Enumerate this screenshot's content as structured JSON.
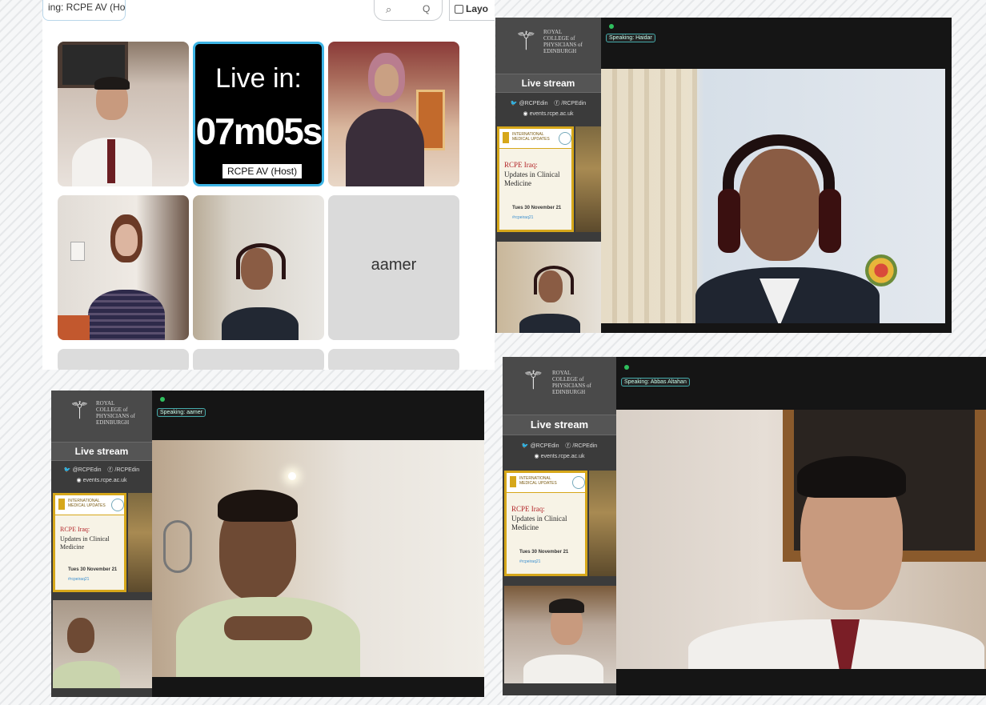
{
  "gallery": {
    "header_label": "ing: RCPE AV (Host)",
    "search_placeholder": "Q",
    "layout_label": "Layo",
    "countdown_line1": "Live in:",
    "countdown_line2": "07m05s",
    "host_label": "RCPE AV  (Host)",
    "name_tile": "aamer"
  },
  "stream_common": {
    "org_line1": "ROYAL",
    "org_line2": "COLLEGE of",
    "org_line3": "PHYSICIANS of",
    "org_line4": "EDINBURGH",
    "live_stream": "Live stream",
    "twitter": "@RCPEdin",
    "facebook": "/RCPEdin",
    "website": "events.rcpe.ac.uk",
    "promo_header": "INTERNATIONAL MEDICAL UPDATES",
    "promo_title": "RCPE Iraq:",
    "promo_title2": "Updates in Clinical Medicine",
    "promo_date": "Tues 30 November 21",
    "promo_hashtag": "#rcpeiraq21"
  },
  "stream_top": {
    "speaking": "Speaking: Haidar"
  },
  "stream_left": {
    "speaking": "Speaking: aamer"
  },
  "stream_right": {
    "speaking": "Speaking: Abbas Altahan"
  },
  "colors": {
    "accent": "#3db5e6",
    "gold": "#d6a71a",
    "speaking_dot": "#2fbf5e"
  }
}
